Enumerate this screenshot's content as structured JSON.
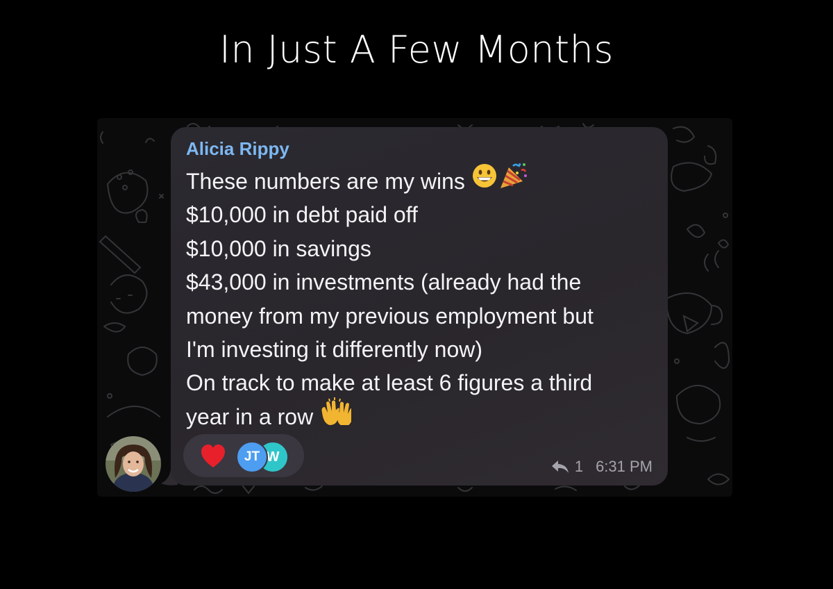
{
  "headline": "In Just A Few Months",
  "chat": {
    "wallpaper_icon": "doodle-pattern-icon",
    "message": {
      "avatar_icon": "user-photo-avatar",
      "sender": "Alicia Rippy",
      "sender_color": "#7db8f2",
      "lines": [
        "These numbers are my wins",
        "$10,000 in debt paid off",
        "$10,000 in savings",
        "$43,000 in investments (already had the",
        "money from my previous employment but",
        "I'm investing it differently now)",
        "On track to make at least 6 figures a third",
        "year in a row"
      ],
      "emojis": {
        "line_0": [
          "grinning-face-icon",
          "party-popper-icon"
        ],
        "line_7": [
          "raising-hands-icon"
        ]
      },
      "reactions": {
        "emoji": "heart-icon",
        "heart_color": "#e8202b",
        "users": [
          {
            "initials": "JT",
            "color": "#4d9df0"
          },
          {
            "initials": "W",
            "color": "#2fc6c9"
          }
        ]
      },
      "reply_icon": "reply-arrow-icon",
      "reply_count": "1",
      "time": "6:31 PM"
    }
  }
}
